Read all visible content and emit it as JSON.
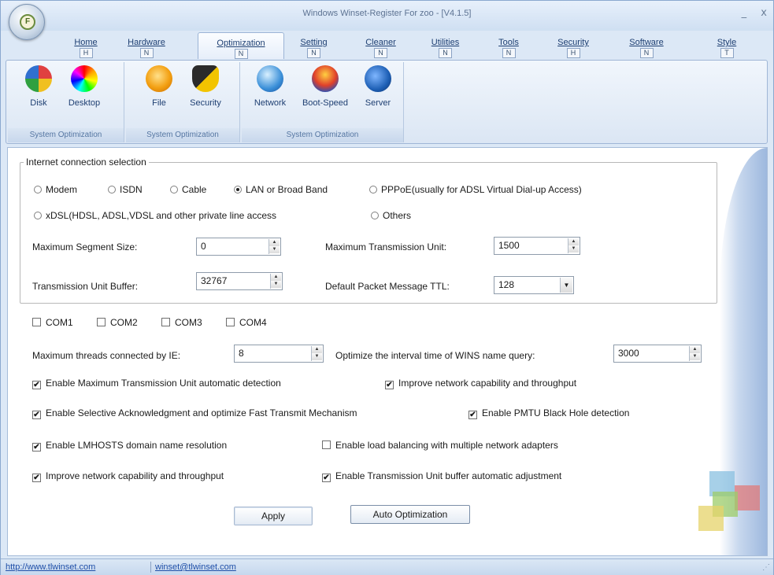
{
  "window": {
    "title": "Windows Winset-Register For zoo - [V4.1.5]",
    "logo_letter": "F",
    "controls": [
      "_",
      "x"
    ]
  },
  "tabs": [
    {
      "label": "Home",
      "key": "H"
    },
    {
      "label": "Hardware",
      "key": "N"
    },
    {
      "label": "Optimization",
      "key": "N",
      "active": true
    },
    {
      "label": "Setting",
      "key": "N"
    },
    {
      "label": "Cleaner",
      "key": "N"
    },
    {
      "label": "Utilities",
      "key": "N"
    },
    {
      "label": "Tools",
      "key": "N"
    },
    {
      "label": "Security",
      "key": "H"
    },
    {
      "label": "Software",
      "key": "N"
    },
    {
      "label": "Style",
      "key": "T"
    }
  ],
  "ribbon": {
    "groups": [
      {
        "caption": "System Optimization",
        "buttons": [
          {
            "label": "Disk",
            "icon": "disk-icon"
          },
          {
            "label": "Desktop",
            "icon": "desktop-icon"
          }
        ]
      },
      {
        "caption": "System Optimization",
        "buttons": [
          {
            "label": "File",
            "icon": "file-icon"
          },
          {
            "label": "Security",
            "icon": "security-icon"
          }
        ]
      },
      {
        "caption": "System Optimization",
        "buttons": [
          {
            "label": "Network",
            "icon": "network-icon"
          },
          {
            "label": "Boot-Speed",
            "icon": "boot-speed-icon"
          },
          {
            "label": "Server",
            "icon": "server-icon"
          }
        ]
      }
    ]
  },
  "connection": {
    "legend": "Internet connection selection",
    "options": [
      {
        "label": "Modem",
        "selected": false
      },
      {
        "label": "ISDN",
        "selected": false
      },
      {
        "label": "Cable",
        "selected": false
      },
      {
        "label": "LAN or Broad Band",
        "selected": true
      },
      {
        "label": "PPPoE(usually for ADSL Virtual Dial-up Access)",
        "selected": false
      },
      {
        "label": "xDSL(HDSL, ADSL,VDSL and other private line access",
        "selected": false
      },
      {
        "label": "Others",
        "selected": false
      }
    ],
    "mss_label": "Maximum Segment Size:",
    "mss_value": "0",
    "mtu_label": "Maximum Transmission Unit:",
    "mtu_value": "1500",
    "tub_label": "Transmission Unit Buffer:",
    "tub_value": "32767",
    "ttl_label": "Default Packet Message TTL:",
    "ttl_value": "128"
  },
  "com_ports": [
    {
      "label": "COM1",
      "checked": false
    },
    {
      "label": "COM2",
      "checked": false
    },
    {
      "label": "COM3",
      "checked": false
    },
    {
      "label": "COM4",
      "checked": false
    }
  ],
  "threads_label": "Maximum threads connected by IE:",
  "threads_value": "8",
  "wins_label": "Optimize the interval time of WINS name query:",
  "wins_value": "3000",
  "options": [
    {
      "label": "Enable Maximum Transmission Unit automatic detection",
      "checked": true
    },
    {
      "label": "Improve network capability and throughput",
      "checked": true
    },
    {
      "label": "Enable Selective Acknowledgment and optimize Fast Transmit Mechanism",
      "checked": true
    },
    {
      "label": "Enable PMTU Black Hole detection",
      "checked": true
    },
    {
      "label": "Enable LMHOSTS domain name resolution",
      "checked": true
    },
    {
      "label": "Enable load balancing with multiple network adapters",
      "checked": false
    },
    {
      "label": "Improve network capability and throughput",
      "checked": true
    },
    {
      "label": "Enable Transmission Unit buffer automatic adjustment",
      "checked": true
    }
  ],
  "buttons": {
    "apply": "Apply",
    "auto": "Auto Optimization"
  },
  "status": {
    "link1": "http://www.tlwinset.com",
    "link2": "winset@tlwinset.com"
  },
  "check_mark": "✔"
}
